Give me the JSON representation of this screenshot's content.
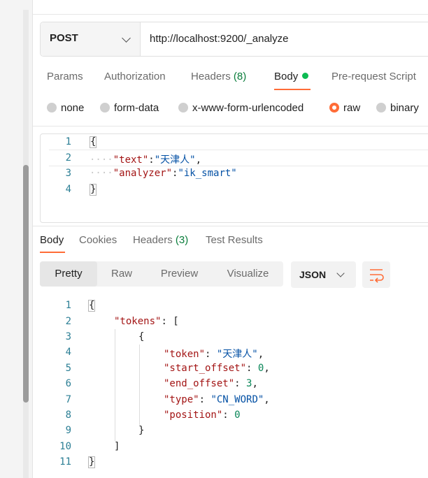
{
  "request": {
    "method": "POST",
    "url": "http://localhost:9200/_analyze"
  },
  "request_tabs": [
    {
      "label": "Params"
    },
    {
      "label": "Authorization"
    },
    {
      "label": "Headers",
      "count": "(8)"
    },
    {
      "label": "Body",
      "active": true
    },
    {
      "label": "Pre-request Script"
    }
  ],
  "body_types": [
    {
      "label": "none"
    },
    {
      "label": "form-data"
    },
    {
      "label": "x-www-form-urlencoded"
    },
    {
      "label": "raw",
      "selected": true
    },
    {
      "label": "binary"
    }
  ],
  "request_body": {
    "line_numbers": [
      "1",
      "2",
      "3",
      "4"
    ],
    "open_brace": "{",
    "close_brace": "}",
    "fields": [
      {
        "key": "\"text\"",
        "colon": ":",
        "value": "\"天津人\"",
        "comma": ","
      },
      {
        "key": "\"analyzer\"",
        "colon": ":",
        "value": "\"ik_smart\"",
        "comma": ""
      }
    ],
    "indent_marker": "····"
  },
  "response_tabs": [
    {
      "label": "Body",
      "active": true
    },
    {
      "label": "Cookies"
    },
    {
      "label": "Headers",
      "count": "(3)"
    },
    {
      "label": "Test Results"
    }
  ],
  "view_modes": [
    {
      "label": "Pretty",
      "active": true
    },
    {
      "label": "Raw"
    },
    {
      "label": "Preview"
    },
    {
      "label": "Visualize"
    }
  ],
  "format_select": "JSON",
  "wrap_icon": "text-wrap-icon",
  "response_body": {
    "line_numbers": [
      "1",
      "2",
      "3",
      "4",
      "5",
      "6",
      "7",
      "8",
      "9",
      "10",
      "11"
    ],
    "open_brace": "{",
    "close_brace": "}",
    "tokens_key": "\"tokens\"",
    "colon": ": ",
    "open_bracket": "[",
    "close_bracket": "]",
    "inner_open": "{",
    "inner_close": "}",
    "fields": [
      {
        "key": "\"token\"",
        "value": "\"天津人\"",
        "type": "string",
        "comma": ","
      },
      {
        "key": "\"start_offset\"",
        "value": "0",
        "type": "number",
        "comma": ","
      },
      {
        "key": "\"end_offset\"",
        "value": "3",
        "type": "number",
        "comma": ","
      },
      {
        "key": "\"type\"",
        "value": "\"CN_WORD\"",
        "type": "string",
        "comma": ","
      },
      {
        "key": "\"position\"",
        "value": "0",
        "type": "number",
        "comma": ""
      }
    ]
  },
  "colors": {
    "accent": "#ff6c37",
    "status_green": "#0cbb52",
    "json_key": "#a31515",
    "json_string": "#0451a5",
    "json_number": "#098658"
  }
}
